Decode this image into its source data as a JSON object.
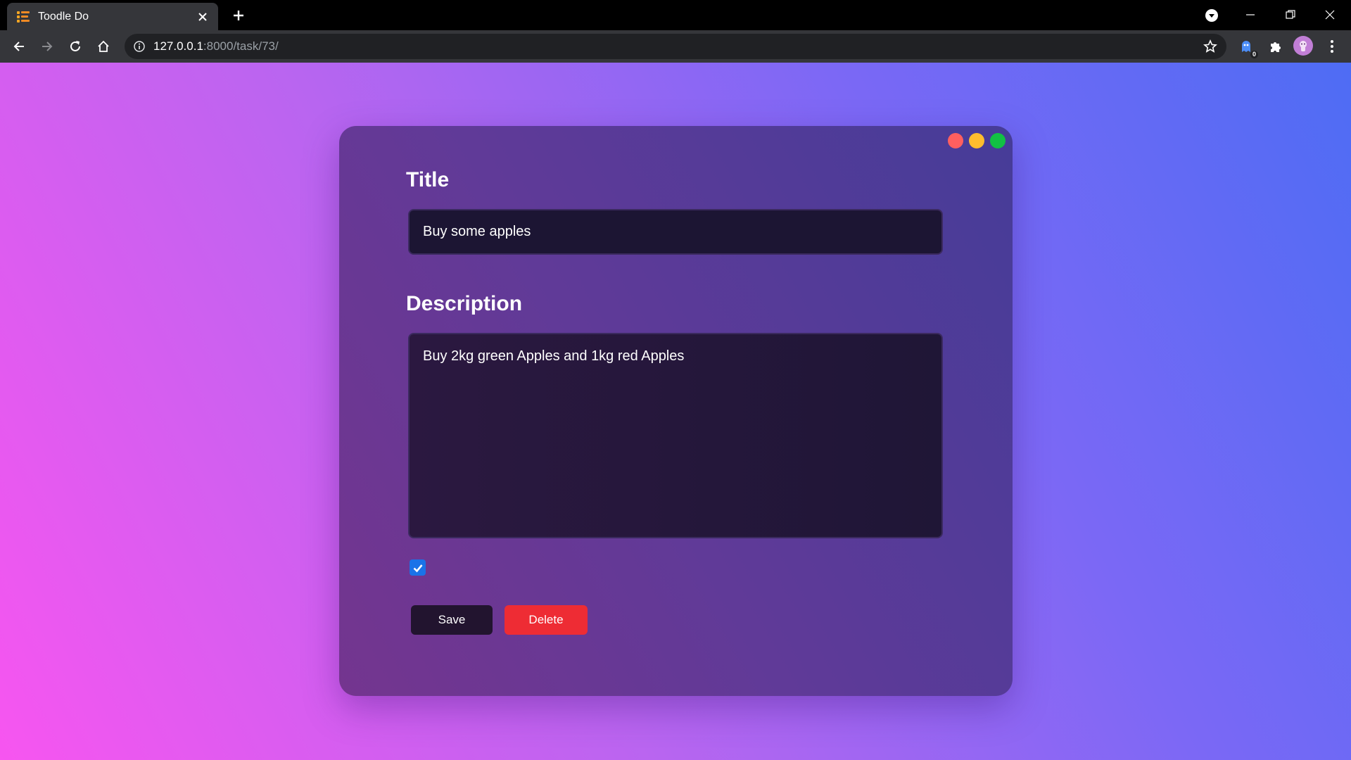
{
  "browser": {
    "tab_title": "Toodle Do",
    "url_host": "127.0.0.1",
    "url_rest": ":8000/task/73/",
    "extension_badge": "0"
  },
  "form": {
    "title_label": "Title",
    "title_value": "Buy some apples",
    "description_label": "Description",
    "description_value": "Buy 2kg green Apples and 1kg red Apples",
    "completed": true,
    "save_label": "Save",
    "delete_label": "Delete"
  },
  "icons": {
    "window_dots": [
      "red-dot-icon",
      "yellow-dot-icon",
      "green-dot-icon"
    ]
  },
  "colors": {
    "dot_red": "#ff5f5f",
    "dot_yellow": "#ffbd2e",
    "dot_green": "#12c044",
    "save_button": "#22142f",
    "delete_button": "#ee2c34",
    "checkbox": "#1a73e8"
  }
}
